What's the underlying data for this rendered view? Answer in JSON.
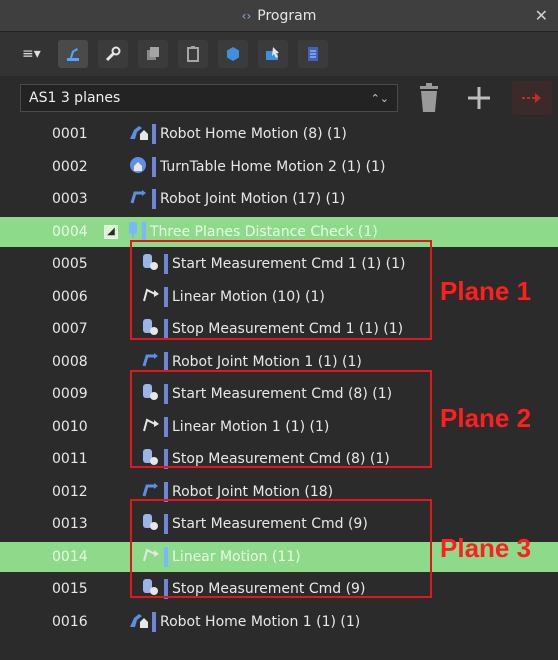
{
  "window": {
    "title": "Program",
    "close_glyph": "✕"
  },
  "toolbar": {
    "menu_label": "≡▾",
    "buttons": [
      {
        "icon": "robot-arm-icon"
      },
      {
        "icon": "wrench-icon"
      },
      {
        "icon": "copy-icon"
      },
      {
        "icon": "paste-icon"
      },
      {
        "icon": "cube-icon"
      },
      {
        "icon": "select-icon"
      },
      {
        "icon": "list-icon"
      }
    ]
  },
  "program_selector": {
    "value": "AS1 3 planes",
    "arrows": "⌃⌄"
  },
  "rows": [
    {
      "num": "0001",
      "label": "Robot Home Motion (8) (1)",
      "icon": "robot-home-icon",
      "indent": 0,
      "highlight": false
    },
    {
      "num": "0002",
      "label": "TurnTable Home Motion 2 (1) (1)",
      "icon": "turntable-home-icon",
      "indent": 0,
      "highlight": false
    },
    {
      "num": "0003",
      "label": "Robot Joint Motion (17) (1)",
      "icon": "joint-motion-icon",
      "indent": 0,
      "highlight": false
    },
    {
      "num": "0004",
      "label": "Three Planes Distance Check (1)",
      "icon": "probe-icon",
      "indent": 0,
      "highlight": true,
      "collapsible": true
    },
    {
      "num": "0005",
      "label": "Start Measurement Cmd 1 (1) (1)",
      "icon": "measurement-cmd-icon",
      "indent": 1,
      "highlight": false
    },
    {
      "num": "0006",
      "label": "Linear Motion (10) (1)",
      "icon": "linear-motion-icon",
      "indent": 1,
      "highlight": false
    },
    {
      "num": "0007",
      "label": "Stop Measurement Cmd 1 (1) (1)",
      "icon": "measurement-cmd-icon",
      "indent": 1,
      "highlight": false
    },
    {
      "num": "0008",
      "label": "Robot Joint Motion 1 (1) (1)",
      "icon": "joint-motion-icon",
      "indent": 1,
      "highlight": false
    },
    {
      "num": "0009",
      "label": "Start Measurement Cmd (8) (1)",
      "icon": "measurement-cmd-icon",
      "indent": 1,
      "highlight": false
    },
    {
      "num": "0010",
      "label": "Linear Motion 1 (1) (1)",
      "icon": "linear-motion-icon",
      "indent": 1,
      "highlight": false
    },
    {
      "num": "0011",
      "label": "Stop Measurement Cmd (8) (1)",
      "icon": "measurement-cmd-icon",
      "indent": 1,
      "highlight": false
    },
    {
      "num": "0012",
      "label": "Robot Joint Motion (18)",
      "icon": "joint-motion-icon",
      "indent": 1,
      "highlight": false
    },
    {
      "num": "0013",
      "label": "Start Measurement Cmd (9)",
      "icon": "measurement-cmd-icon",
      "indent": 1,
      "highlight": false
    },
    {
      "num": "0014",
      "label": "Linear Motion (11)",
      "icon": "linear-motion-icon",
      "indent": 1,
      "highlight": true
    },
    {
      "num": "0015",
      "label": "Stop Measurement Cmd (9)",
      "icon": "measurement-cmd-icon",
      "indent": 1,
      "highlight": false
    },
    {
      "num": "0016",
      "label": "Robot Home Motion 1 (1) (1)",
      "icon": "robot-home-icon",
      "indent": 0,
      "highlight": false
    }
  ],
  "annotations": [
    {
      "label": "Plane 1"
    },
    {
      "label": "Plane 2"
    },
    {
      "label": "Plane 3"
    }
  ],
  "colors": {
    "highlight_row": "#8ddb8a",
    "annotation_red": "#e01818",
    "command_bar": "#6f86d8"
  }
}
